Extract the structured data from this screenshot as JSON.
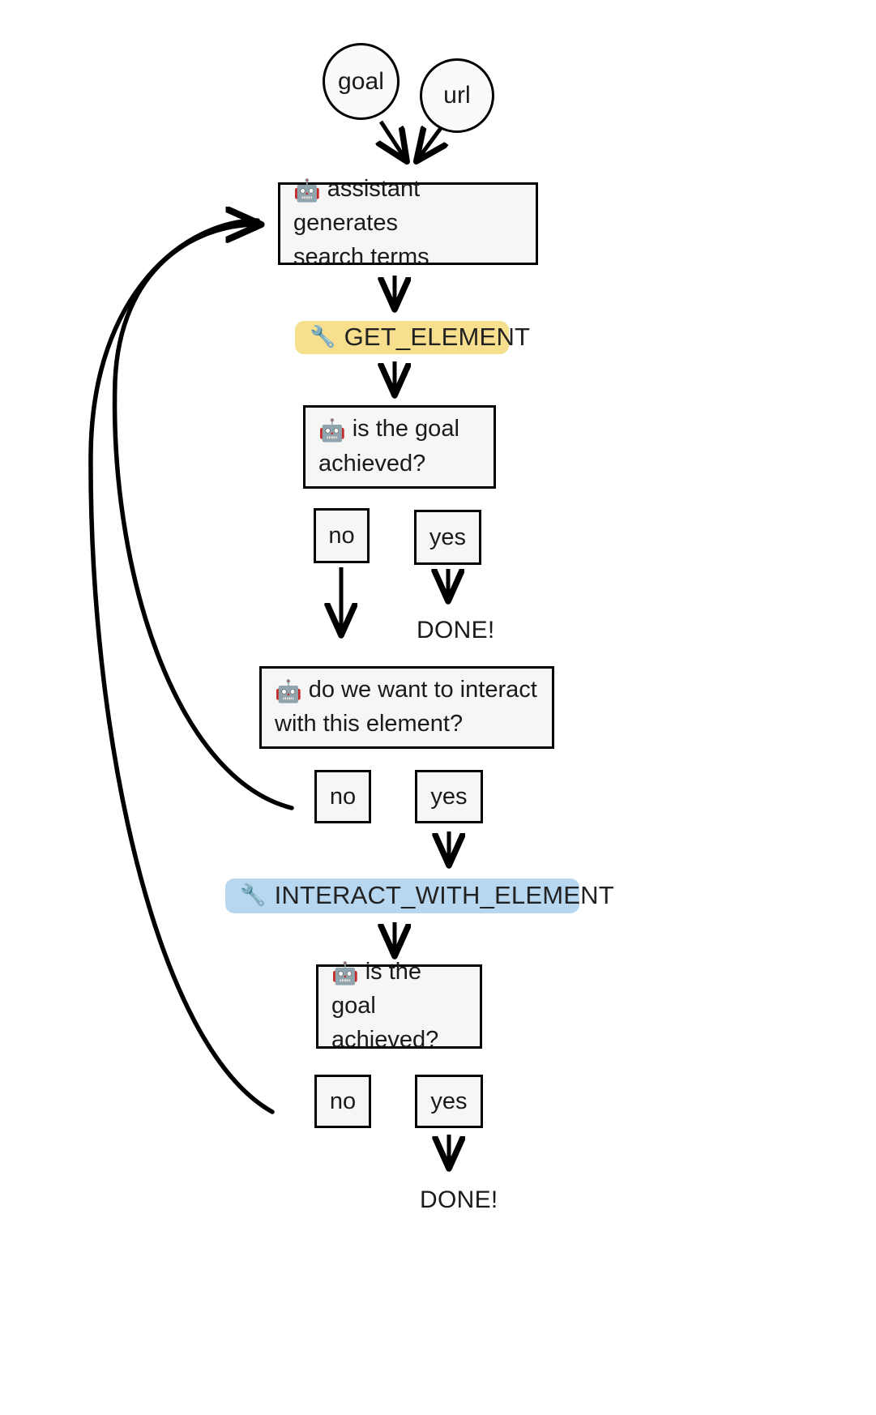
{
  "diagram": {
    "title": "agent loop flowchart",
    "colors": {
      "node_fill": "#f6f6f6",
      "node_stroke": "#000000",
      "get_element_bg": "#f8df8e",
      "interact_element_bg": "#b7d7f0",
      "arrow": "#000000"
    },
    "inputs": [
      {
        "id": "goal",
        "label": "goal",
        "shape": "circle"
      },
      {
        "id": "url",
        "label": "url",
        "shape": "circle"
      }
    ],
    "steps": {
      "assistant_search_terms": {
        "emoji": "🤖",
        "emoji_name": "robot-icon",
        "line1": "assistant generates",
        "line2": "search terms"
      },
      "get_element_tool": {
        "emoji": "🔧",
        "emoji_name": "wrench-icon",
        "label": "GET_ELEMENT"
      },
      "goal_check_1": {
        "emoji": "🤖",
        "emoji_name": "robot-icon",
        "line1": "is the goal",
        "line2": "achieved?"
      },
      "interact_question": {
        "emoji": "🤖",
        "emoji_name": "robot-icon",
        "line1": "do we want to interact",
        "line2": "with this element?"
      },
      "interact_element_tool": {
        "emoji": "🔧",
        "emoji_name": "wrench-icon",
        "label": "INTERACT_WITH_ELEMENT"
      },
      "goal_check_2": {
        "emoji": "🤖",
        "emoji_name": "robot-icon",
        "line1": "is the goal",
        "line2": "achieved?"
      }
    },
    "branches": {
      "goal_check_1_no": "no",
      "goal_check_1_yes": "yes",
      "interact_question_no": "no",
      "interact_question_yes": "yes",
      "goal_check_2_no": "no",
      "goal_check_2_yes": "yes"
    },
    "terminals": {
      "done_1": "DONE!",
      "done_2": "DONE!"
    }
  }
}
